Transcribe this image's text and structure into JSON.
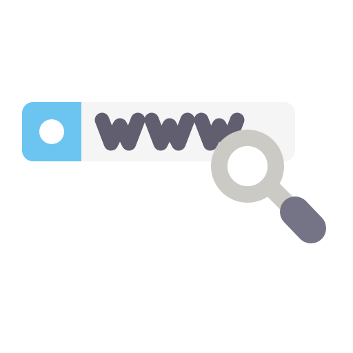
{
  "illustration": {
    "address_text": "www",
    "icons": {
      "address_bar": "address-bar-icon",
      "globe": "globe-dot-icon",
      "magnifier": "magnifying-glass-icon"
    },
    "colors": {
      "accent": "#6CC4F0",
      "bar": "#F5F5F5",
      "text": "#605E6F",
      "lens": "#CCCAC4",
      "handle": "#757487",
      "white": "#FFFFFF"
    }
  }
}
